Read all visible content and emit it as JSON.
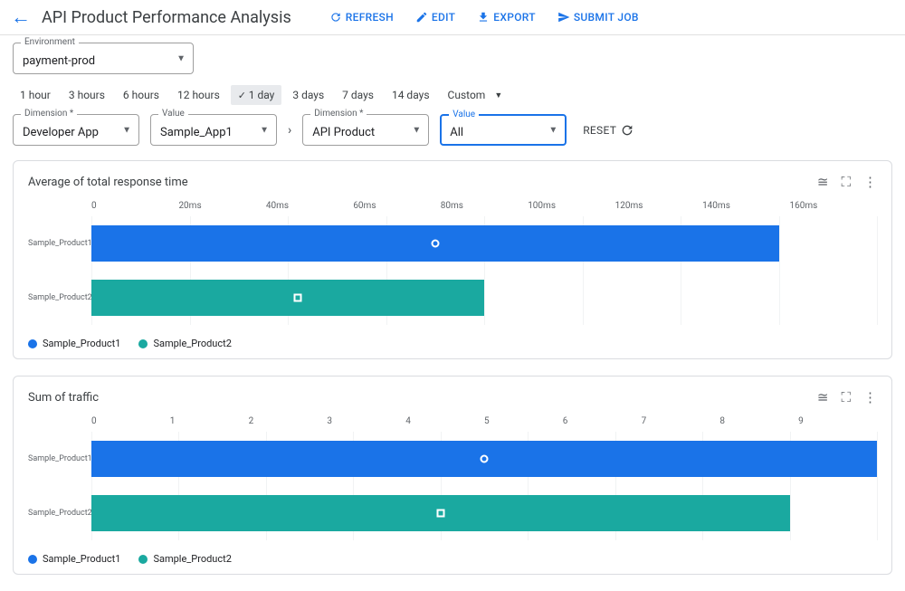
{
  "title": "API Product Performance Analysis",
  "actions": {
    "refresh": "REFRESH",
    "edit": "EDIT",
    "export": "EXPORT",
    "submit": "SUBMIT JOB"
  },
  "env": {
    "label": "Environment",
    "value": "payment-prod"
  },
  "time_options": [
    "1 hour",
    "3 hours",
    "6 hours",
    "12 hours",
    "1 day",
    "3 days",
    "7 days",
    "14 days",
    "Custom"
  ],
  "time_selected": "1 day",
  "filters": {
    "dim1": {
      "label": "Dimension *",
      "value": "Developer App"
    },
    "val1": {
      "label": "Value",
      "value": "Sample_App1"
    },
    "dim2": {
      "label": "Dimension *",
      "value": "API Product"
    },
    "val2": {
      "label": "Value",
      "value": "All"
    },
    "reset": "RESET"
  },
  "chart1": {
    "title": "Average of total response time",
    "legend": [
      "Sample_Product1",
      "Sample_Product2"
    ]
  },
  "chart2": {
    "title": "Sum of traffic",
    "legend": [
      "Sample_Product1",
      "Sample_Product2"
    ]
  },
  "chart_data": [
    {
      "type": "bar",
      "orientation": "horizontal",
      "title": "Average of total response time",
      "xlabel": "",
      "ylabel": "",
      "categories": [
        "Sample_Product1",
        "Sample_Product2"
      ],
      "ticks": [
        "0",
        "20ms",
        "40ms",
        "60ms",
        "80ms",
        "100ms",
        "120ms",
        "140ms",
        "160ms"
      ],
      "xlim": [
        0,
        160
      ],
      "series": [
        {
          "name": "Sample_Product1",
          "color": "#1a73e8",
          "values": [
            140
          ]
        },
        {
          "name": "Sample_Product2",
          "color": "#1aa9a0",
          "values": [
            80
          ]
        }
      ],
      "markers": {
        "Sample_Product1": 70,
        "Sample_Product2": 42
      }
    },
    {
      "type": "bar",
      "orientation": "horizontal",
      "title": "Sum of traffic",
      "xlabel": "",
      "ylabel": "",
      "categories": [
        "Sample_Product1",
        "Sample_Product2"
      ],
      "ticks": [
        "0",
        "1",
        "2",
        "3",
        "4",
        "5",
        "6",
        "7",
        "8",
        "9"
      ],
      "xlim": [
        0,
        9
      ],
      "series": [
        {
          "name": "Sample_Product1",
          "color": "#1a73e8",
          "values": [
            9.0
          ]
        },
        {
          "name": "Sample_Product2",
          "color": "#1aa9a0",
          "values": [
            8.0
          ]
        }
      ],
      "markers": {
        "Sample_Product1": 4.5,
        "Sample_Product2": 4.0
      }
    }
  ]
}
